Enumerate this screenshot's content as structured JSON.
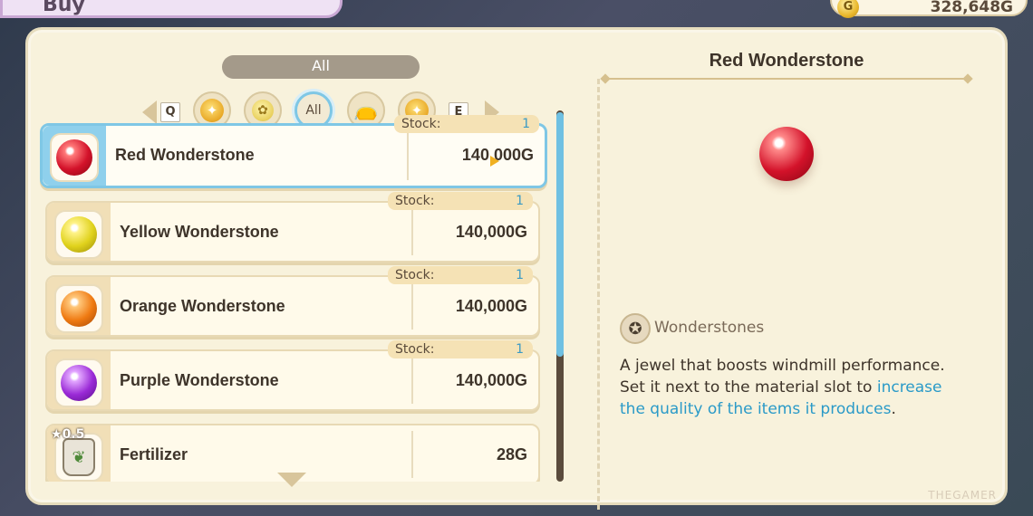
{
  "header": {
    "tab_title": "Buy",
    "money": "328,648G",
    "coin_label": "G"
  },
  "category": {
    "current_label": "All",
    "prev_key": "Q",
    "next_key": "E",
    "active_icon_label": "All"
  },
  "items": [
    {
      "name": "Red Wonderstone",
      "price": "140,000G",
      "stock_label": "Stock:",
      "stock": "1",
      "gem": "red",
      "selected": true
    },
    {
      "name": "Yellow Wonderstone",
      "price": "140,000G",
      "stock_label": "Stock:",
      "stock": "1",
      "gem": "yellow"
    },
    {
      "name": "Orange Wonderstone",
      "price": "140,000G",
      "stock_label": "Stock:",
      "stock": "1",
      "gem": "orange"
    },
    {
      "name": "Purple Wonderstone",
      "price": "140,000G",
      "stock_label": "Stock:",
      "stock": "1",
      "gem": "purple"
    },
    {
      "name": "Fertilizer",
      "price": "28G",
      "rating": "0.5",
      "icon": "seed-bag"
    }
  ],
  "detail": {
    "title": "Red Wonderstone",
    "category": "Wonderstones",
    "description_plain": "A jewel that boosts windmill performance. Set it next to the material slot to ",
    "description_highlight": "increase the quality of the items it produces",
    "description_end": "."
  },
  "watermark": "THEGAMER",
  "colors": {
    "accent": "#7fc7e5",
    "highlight_text": "#2a9ac8",
    "panel": "#f8f2dc"
  }
}
